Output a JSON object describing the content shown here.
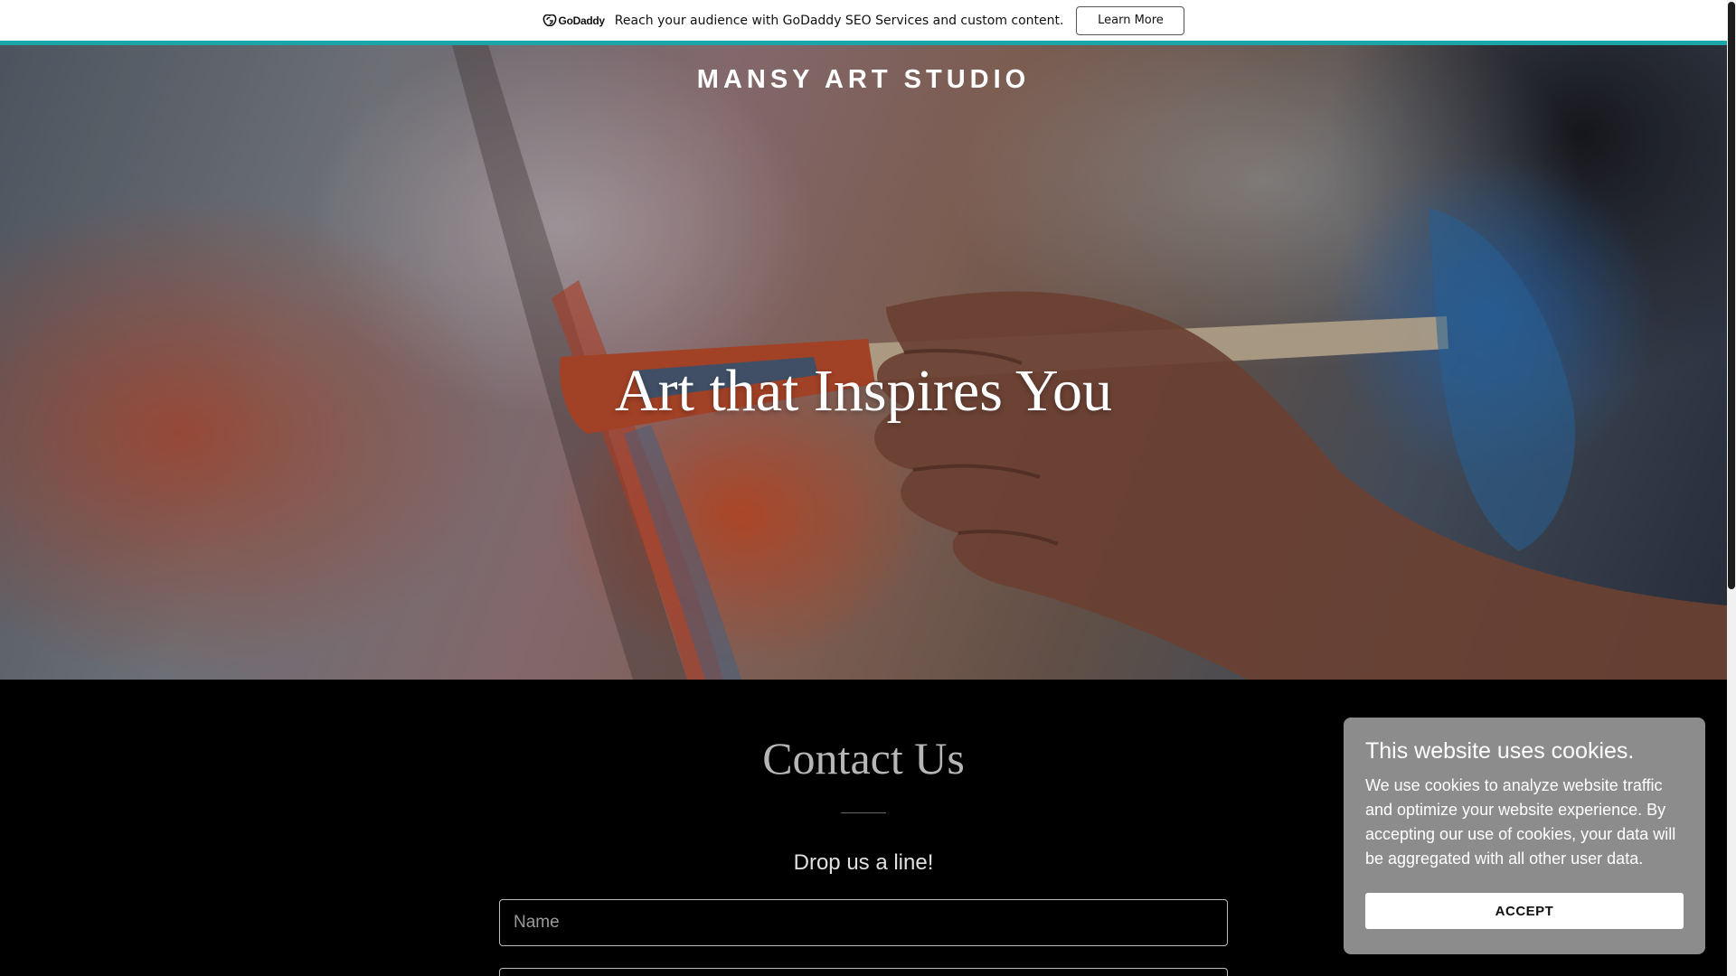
{
  "promo_banner": {
    "logo_text": "GoDaddy",
    "message": "Reach your audience with GoDaddy SEO Services and custom content.",
    "cta_label": "Learn More",
    "accent_color": "#1aa5a8"
  },
  "header": {
    "site_title": "MANSY ART STUDIO"
  },
  "hero": {
    "headline": "Art that Inspires You"
  },
  "contact": {
    "title": "Contact Us",
    "subtitle": "Drop us a line!",
    "fields": {
      "name_placeholder": "Name",
      "name_value": ""
    }
  },
  "cookie_notice": {
    "title": "This website uses cookies.",
    "body": "We use cookies to analyze website traffic and optimize your website experience. By accepting our use of cookies, your data will be aggregated with all other user data.",
    "accept_label": "ACCEPT",
    "background_color": "#8c8c8c"
  },
  "icons": {
    "godaddy_logo": "godaddy-logo-icon"
  }
}
